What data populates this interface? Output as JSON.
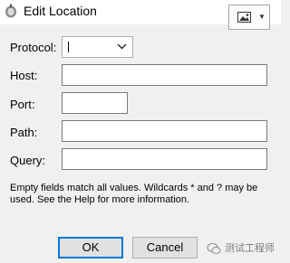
{
  "window": {
    "title": "Edit Location"
  },
  "form": {
    "protocol": {
      "label": "Protocol:",
      "value": ""
    },
    "host": {
      "label": "Host:",
      "value": ""
    },
    "port": {
      "label": "Port:",
      "value": ""
    },
    "path": {
      "label": "Path:",
      "value": ""
    },
    "query": {
      "label": "Query:",
      "value": ""
    }
  },
  "help_text": "Empty fields match all values. Wildcards * and ? may be used. See the Help for more information.",
  "buttons": {
    "ok": "OK",
    "cancel": "Cancel"
  },
  "watermark": "测试工程师"
}
